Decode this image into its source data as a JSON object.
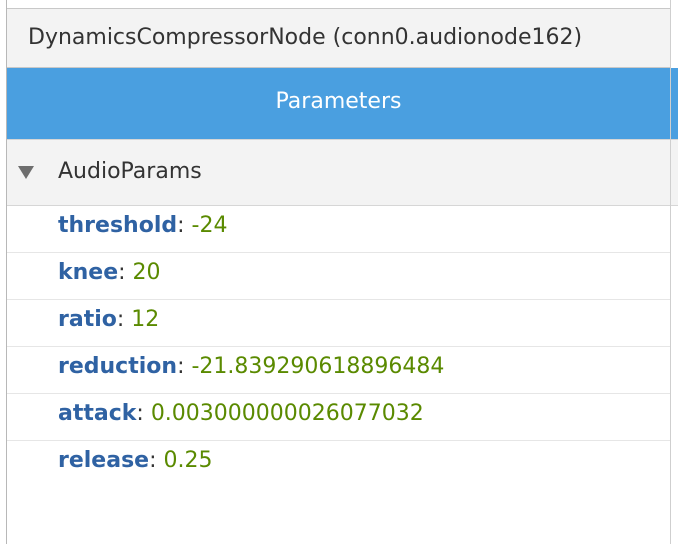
{
  "window": {
    "title": "DynamicsCompressorNode (conn0.audionode162)"
  },
  "tabs": {
    "parameters_label": "Parameters"
  },
  "section": {
    "label": "AudioParams",
    "expanded": true
  },
  "params": [
    {
      "key": "threshold",
      "sep": ": ",
      "value": "-24"
    },
    {
      "key": "knee",
      "sep": ": ",
      "value": "20"
    },
    {
      "key": "ratio",
      "sep": ": ",
      "value": "12"
    },
    {
      "key": "reduction",
      "sep": ": ",
      "value": "-21.839290618896484"
    },
    {
      "key": "attack",
      "sep": ": ",
      "value": "0.003000000026077032"
    },
    {
      "key": "release",
      "sep": ": ",
      "value": "0.25"
    }
  ],
  "colors": {
    "header_blue": "#4a9fe0",
    "key_blue": "#2f62a3",
    "value_green": "#5a8a00"
  }
}
